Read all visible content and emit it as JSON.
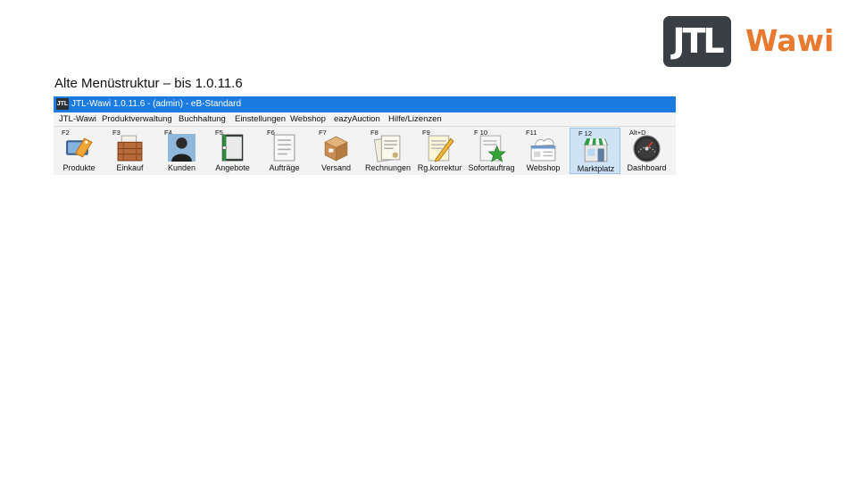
{
  "logo": {
    "mark": "JTL",
    "word": "Wawi"
  },
  "caption": "Alte Menüstruktur – bis 1.0.11.6",
  "window": {
    "icon_text": "JTL",
    "title": "JTL-Wawi 1.0.11.6 - (admin) - eB-Standard"
  },
  "menu": [
    "JTL-Wawi",
    "Produktverwaltung",
    "Buchhaltung",
    "Einstellungen",
    "Webshop",
    "eazyAuction",
    "Hilfe/Lizenzen"
  ],
  "toolbar": [
    {
      "key": "F2",
      "label": "Produkte",
      "icon": "product-tag-icon"
    },
    {
      "key": "F3",
      "label": "Einkauf",
      "icon": "crate-icon"
    },
    {
      "key": "F4",
      "label": "Kunden",
      "icon": "person-icon"
    },
    {
      "key": "F5",
      "label": "Angebote",
      "icon": "binder-icon"
    },
    {
      "key": "F6",
      "label": "Aufträge",
      "icon": "order-list-icon"
    },
    {
      "key": "F7",
      "label": "Versand",
      "icon": "package-icon"
    },
    {
      "key": "F8",
      "label": "Rechnungen",
      "icon": "invoice-icon"
    },
    {
      "key": "F9",
      "label": "Rg.korrektur",
      "icon": "correction-pencil-icon"
    },
    {
      "key": "F 10",
      "label": "Sofortauftrag",
      "icon": "star-document-icon"
    },
    {
      "key": "F11",
      "label": "Webshop",
      "icon": "web-cloud-icon"
    },
    {
      "key": "F 12",
      "label": "Marktplatz",
      "icon": "storefront-icon"
    },
    {
      "key": "Alt+D",
      "label": "Dashboard",
      "icon": "speedometer-icon"
    }
  ],
  "active_item": "Marktplatz"
}
